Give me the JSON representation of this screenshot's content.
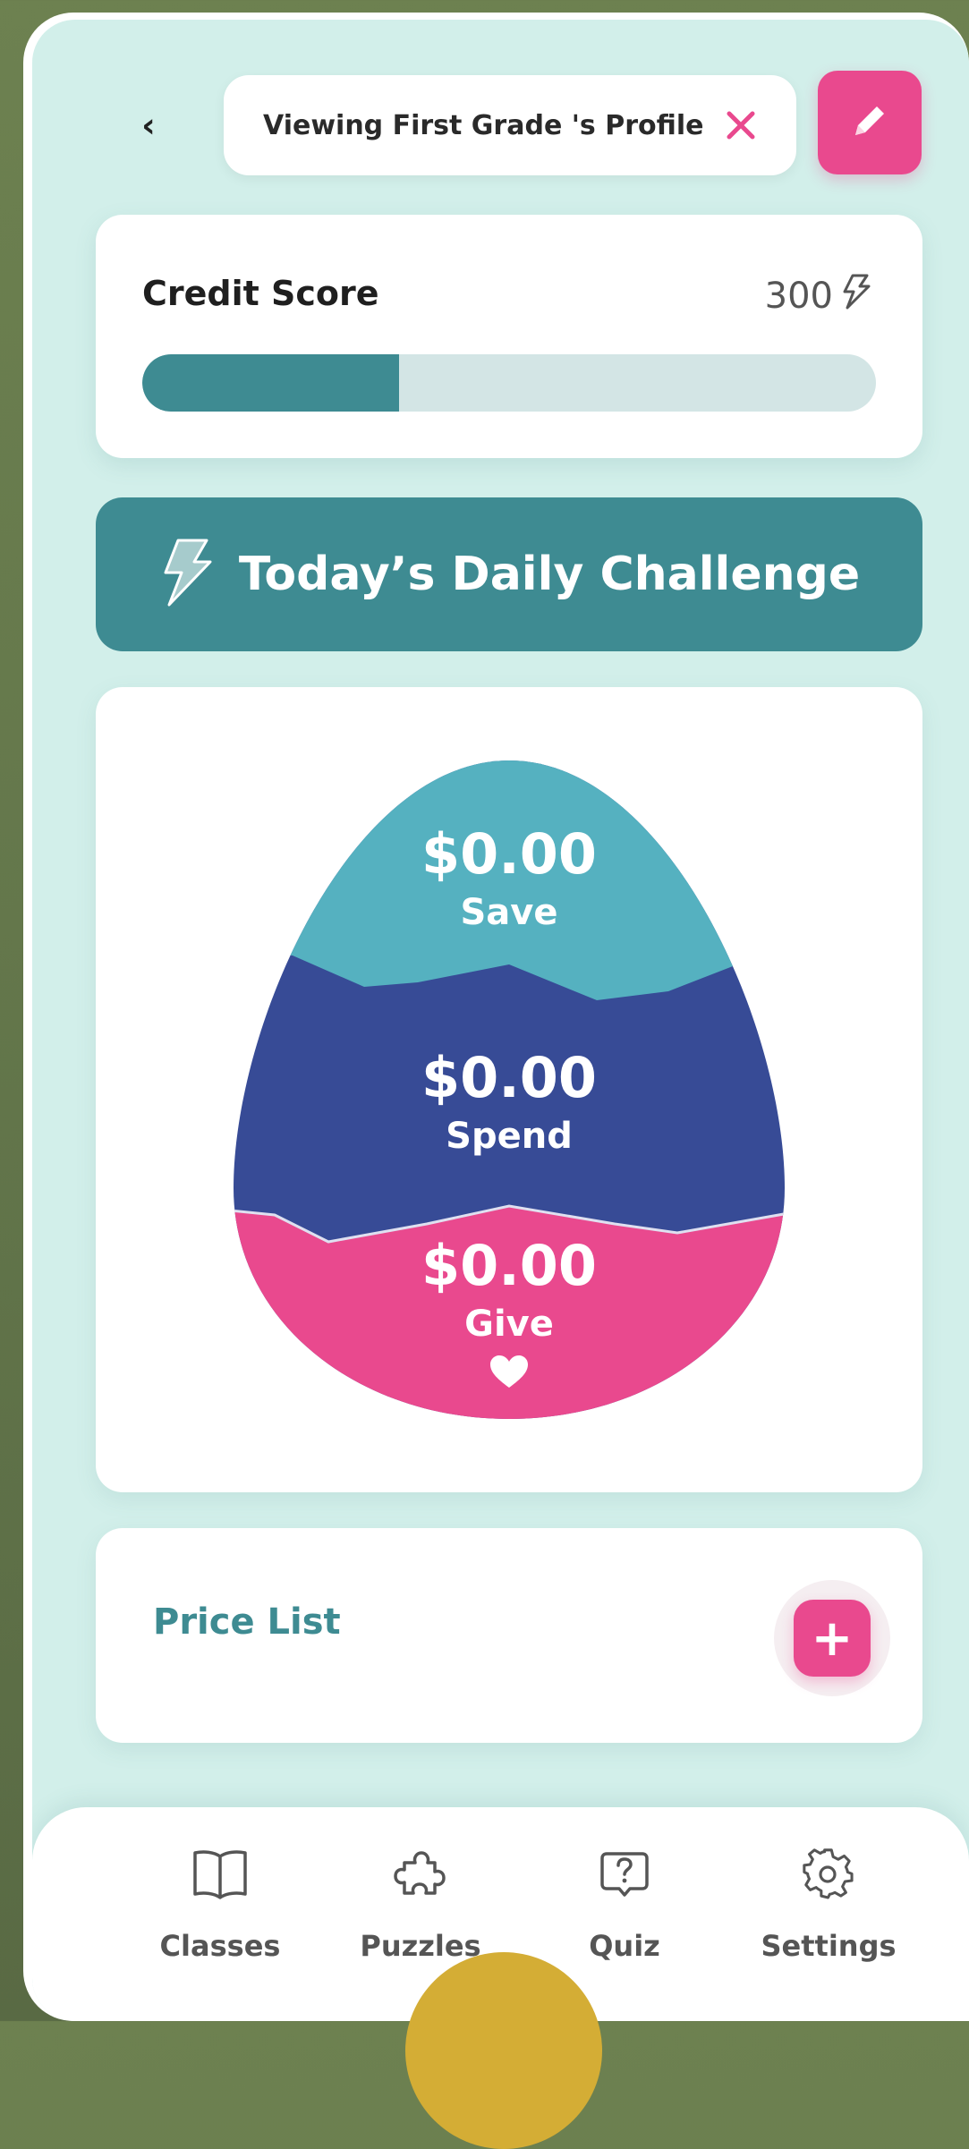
{
  "header": {
    "back_label": "‹",
    "profile_banner": "Viewing First Grade 's Profile"
  },
  "credit": {
    "title": "Credit Score",
    "value": "300",
    "progress_fraction": 0.35
  },
  "challenge": {
    "label": "Today’s Daily Challenge"
  },
  "jars": {
    "save": {
      "amount": "$0.00",
      "label": "Save",
      "color": "#55b1c0"
    },
    "spend": {
      "amount": "$0.00",
      "label": "Spend",
      "color": "#374b96"
    },
    "give": {
      "amount": "$0.00",
      "label": "Give",
      "color": "#e9498e"
    }
  },
  "price_list": {
    "title": "Price List",
    "add_label": "+"
  },
  "nav": {
    "items": [
      {
        "label": "Classes",
        "icon": "book-icon"
      },
      {
        "label": "Puzzles",
        "icon": "puzzle-icon"
      },
      {
        "label": "Quiz",
        "icon": "question-icon"
      },
      {
        "label": "Settings",
        "icon": "gear-icon"
      }
    ]
  },
  "colors": {
    "accent_teal": "#3e8b92",
    "accent_pink": "#e9498e",
    "screen_bg": "#d2efea"
  }
}
